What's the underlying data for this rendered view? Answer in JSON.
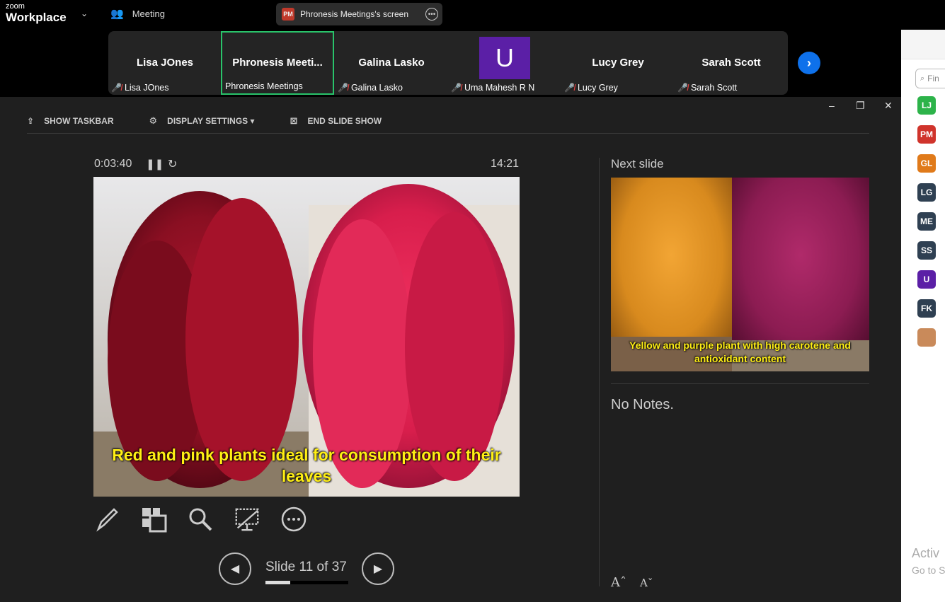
{
  "app": {
    "brand_small": "zoom",
    "brand_big": "Workplace",
    "meeting_tab": "Meeting",
    "share_title": "Phronesis Meetings's screen",
    "share_badge": "PM"
  },
  "participants": [
    {
      "name": "Lisa JOnes",
      "label": "Lisa JOnes",
      "muted": true
    },
    {
      "name": "Phronesis  Meeti...",
      "label": "Phronesis Meetings",
      "muted": false,
      "active": true
    },
    {
      "name": "Galina Lasko",
      "label": "Galina Lasko",
      "muted": true
    },
    {
      "name": "U",
      "label": "Uma Mahesh R N",
      "muted": true,
      "avatar_letter": "U"
    },
    {
      "name": "Lucy Grey",
      "label": "Lucy Grey",
      "muted": true
    },
    {
      "name": "Sarah Scott",
      "label": "Sarah Scott",
      "muted": true
    }
  ],
  "toolbar": {
    "show_taskbar": "SHOW TASKBAR",
    "display_settings": "DISPLAY SETTINGS ▾",
    "end_slide_show": "END SLIDE SHOW"
  },
  "presenter": {
    "elapsed": "0:03:40",
    "clock": "14:21",
    "current_caption": "Red and pink plants ideal for consumption of their leaves",
    "next_label": "Next slide",
    "next_caption": "Yellow and purple plant with high carotene and antioxidant content",
    "notes": "No Notes.",
    "slide_prefix": "Slide",
    "slide_current": "11",
    "slide_of": "of",
    "slide_total": "37",
    "progress_fraction": 0.297
  },
  "side_panel": {
    "find_placeholder": "Fin",
    "avatars": [
      {
        "initials": "LJ",
        "color": "#2db34a"
      },
      {
        "initials": "PM",
        "color": "#d0342c"
      },
      {
        "initials": "GL",
        "color": "#e07a1a"
      },
      {
        "initials": "LG",
        "color": "#2f4052"
      },
      {
        "initials": "ME",
        "color": "#2f4052"
      },
      {
        "initials": "SS",
        "color": "#2f4052"
      },
      {
        "initials": "U",
        "color": "#5b1fa6"
      },
      {
        "initials": "FK",
        "color": "#2f4052"
      },
      {
        "initials": "",
        "color": "#c98a5a"
      }
    ],
    "watermark_line1": "Activ",
    "watermark_line2": "Go to S"
  }
}
